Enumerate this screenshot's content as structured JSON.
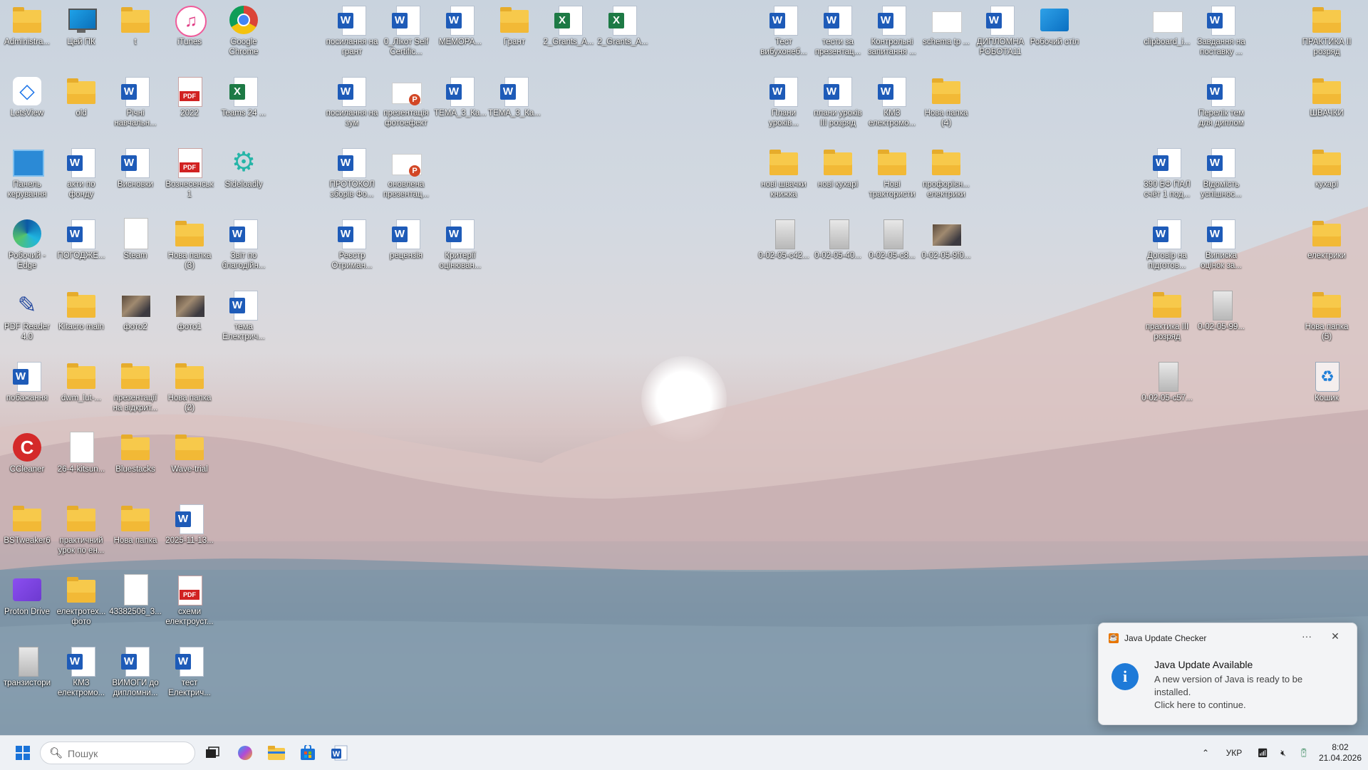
{
  "desktop": {
    "icons": [
      {
        "label": "Administra...",
        "type": "folder"
      },
      {
        "label": "Цей ПК",
        "type": "monitor"
      },
      {
        "label": "t",
        "type": "folder"
      },
      {
        "label": "iTunes",
        "type": "itunes"
      },
      {
        "label": "Google Chrome",
        "type": "chrome"
      },
      {
        "label": "LetsView",
        "type": "letsview"
      },
      {
        "label": "old",
        "type": "folder"
      },
      {
        "label": "Річні навчальн...",
        "type": "word"
      },
      {
        "label": "2022",
        "type": "pdf"
      },
      {
        "label": "Teams 24 ...",
        "type": "excel"
      },
      {
        "label": "Панель керування",
        "type": "panel"
      },
      {
        "label": "акти по фонду",
        "type": "word"
      },
      {
        "label": "Висновки",
        "type": "word"
      },
      {
        "label": "Вознесенськ 1",
        "type": "pdf"
      },
      {
        "label": "Sideloadly",
        "type": "sideloadly"
      },
      {
        "label": "Робочий - Edge",
        "type": "edge"
      },
      {
        "label": "ПОГОДЖЕ...",
        "type": "word"
      },
      {
        "label": "Steam",
        "type": "blank"
      },
      {
        "label": "Нова папка (3)",
        "type": "folder"
      },
      {
        "label": "Звіт по благодійн...",
        "type": "word"
      },
      {
        "label": "PDF Reader 4.0",
        "type": "pdfreader"
      },
      {
        "label": "Kitacro main",
        "type": "folder"
      },
      {
        "label": "фото2",
        "type": "photo"
      },
      {
        "label": "фото1",
        "type": "photo"
      },
      {
        "label": "тема Електрич...",
        "type": "word"
      },
      {
        "label": "побажання",
        "type": "word"
      },
      {
        "label": "dwm_lut-...",
        "type": "folder"
      },
      {
        "label": "презентації на відкрит...",
        "type": "folder"
      },
      {
        "label": "Нова папка (2)",
        "type": "folder"
      },
      {
        "label": "CCleaner",
        "type": "ccleaner"
      },
      {
        "label": "26-4-kitsun...",
        "type": "blank"
      },
      {
        "label": "Bluestacks",
        "type": "folder"
      },
      {
        "label": "Wave-trial",
        "type": "folder"
      },
      {
        "label": "BSTweaker6",
        "type": "folder"
      },
      {
        "label": "практичний урок по ен...",
        "type": "folder"
      },
      {
        "label": "Нова папка",
        "type": "folder"
      },
      {
        "label": "2025-11-13...",
        "type": "word"
      },
      {
        "label": "Proton Drive",
        "type": "proton"
      },
      {
        "label": "електротех... фото",
        "type": "folder"
      },
      {
        "label": "43382506_3...",
        "type": "blank"
      },
      {
        "label": "схеми електроуст...",
        "type": "pdf"
      },
      {
        "label": "транзистори",
        "type": "scan"
      },
      {
        "label": "КМЗ електромо...",
        "type": "word"
      },
      {
        "label": "ВИМОГИ до дипломни...",
        "type": "word"
      },
      {
        "label": "тест Електрич...",
        "type": "word"
      },
      {
        "label": "посилання на грант",
        "type": "word"
      },
      {
        "label": "0_Лікот Self Certific...",
        "type": "word"
      },
      {
        "label": "МЕМОРА...",
        "type": "word"
      },
      {
        "label": "Грант",
        "type": "folder"
      },
      {
        "label": "2_Grants_A...",
        "type": "excel"
      },
      {
        "label": "2_Grants_A...",
        "type": "excel"
      },
      {
        "label": "посилання на зум",
        "type": "word"
      },
      {
        "label": "презентація фотоефект",
        "type": "ppt"
      },
      {
        "label": "ТЕМА_3_Ка...",
        "type": "word"
      },
      {
        "label": "ТЕМА_3_Ка...",
        "type": "word"
      },
      {
        "label": "ПРОТОКОЛ зборів Фо...",
        "type": "word"
      },
      {
        "label": "оновлена презентац...",
        "type": "ppt"
      },
      {
        "label": "Реєстр Отриман...",
        "type": "word"
      },
      {
        "label": "рецензія",
        "type": "word"
      },
      {
        "label": "Критерії оцінюван...",
        "type": "word"
      },
      {
        "label": "Тест вибухонеб...",
        "type": "word"
      },
      {
        "label": "тести за презентац...",
        "type": "word"
      },
      {
        "label": "Контрольні запитання ...",
        "type": "word"
      },
      {
        "label": "schema tp ...",
        "type": "clipboard"
      },
      {
        "label": "ДИПЛОМНА РОБОТА11",
        "type": "word"
      },
      {
        "label": "Робочий стіл",
        "type": "desktopfolder"
      },
      {
        "label": "Плани уроків...",
        "type": "word"
      },
      {
        "label": "плани уроків III розряд",
        "type": "word"
      },
      {
        "label": "КМЗ електромо...",
        "type": "word"
      },
      {
        "label": "Нова папка (4)",
        "type": "folder"
      },
      {
        "label": "нові швачки книжка",
        "type": "folder"
      },
      {
        "label": "нові кухарі",
        "type": "folder"
      },
      {
        "label": "Нові трактористи",
        "type": "folder"
      },
      {
        "label": "профорієн... електрики",
        "type": "folder"
      },
      {
        "label": "0-02-05-c42...",
        "type": "scan"
      },
      {
        "label": "0-02-05-40...",
        "type": "scan"
      },
      {
        "label": "0-02-05-c8...",
        "type": "scan"
      },
      {
        "label": "0-02-05-9f0...",
        "type": "photo"
      },
      {
        "label": "clipboard_i...",
        "type": "clipboard"
      },
      {
        "label": "Завдання на поставку ...",
        "type": "word"
      },
      {
        "label": "ПРАКТИКА II розряд",
        "type": "folder"
      },
      {
        "label": "Перелік тем для диплом",
        "type": "word"
      },
      {
        "label": "ШВАЧКИ",
        "type": "folder"
      },
      {
        "label": "390 БФ ПАЛ счёт 1 под...",
        "type": "word"
      },
      {
        "label": "Відомість успішнос...",
        "type": "word"
      },
      {
        "label": "кухарі",
        "type": "folder"
      },
      {
        "label": "Договір на підготов...",
        "type": "word"
      },
      {
        "label": "Виписка оцінок за...",
        "type": "word"
      },
      {
        "label": "електрики",
        "type": "folder"
      },
      {
        "label": "практика III розряд",
        "type": "folder"
      },
      {
        "label": "0-02-05-99...",
        "type": "scan"
      },
      {
        "label": "Нова папка (5)",
        "type": "folder"
      },
      {
        "label": "0-02-05-c57...",
        "type": "scan"
      },
      {
        "label": "Кошик",
        "type": "recycle"
      }
    ]
  },
  "taskbar": {
    "search_placeholder": "Пошук",
    "language": "УКР",
    "time": "8:02",
    "date": "21.04.2026"
  },
  "toast": {
    "app_name": "Java Update Checker",
    "more_label": "···",
    "close_label": "✕",
    "title": "Java Update Available",
    "body_line1": "A new version of Java is ready to be installed.",
    "body_line2": "Click here to continue."
  },
  "colors": {
    "accent": "#1e7ad8",
    "taskbar_bg": "#eef1f5",
    "folder": "#f7c94b",
    "word": "#1e5bb8",
    "excel": "#1d7a45",
    "pdf": "#d12222"
  }
}
